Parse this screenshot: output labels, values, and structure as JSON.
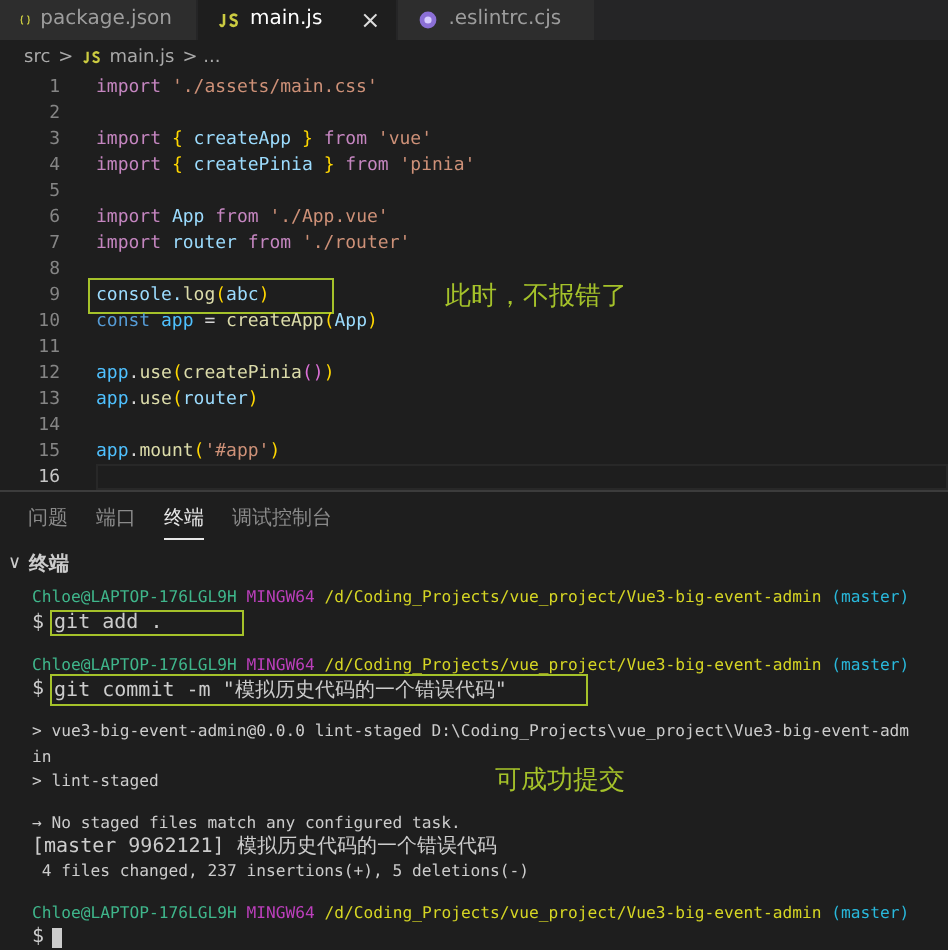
{
  "tabs": [
    {
      "label": "package.json",
      "selected": false
    },
    {
      "label": "main.js",
      "selected": true,
      "close": "×"
    },
    {
      "label": ".eslintrc.cjs",
      "selected": false
    }
  ],
  "breadcrumb": {
    "folder": "src",
    "sep": ">",
    "file": "main.js",
    "more": "> ..."
  },
  "code": [
    {
      "n": "1",
      "tokens": [
        {
          "t": "import ",
          "color": "#c586c0"
        },
        {
          "t": "'./assets/main.css'",
          "color": "#ce9178"
        }
      ]
    },
    {
      "n": "2"
    },
    {
      "n": "3",
      "tokens": [
        {
          "t": "import ",
          "color": "#c586c0"
        },
        {
          "t": "{ ",
          "color": "#ffd700"
        },
        {
          "t": "createApp ",
          "color": "#9cdcfe"
        },
        {
          "t": "} ",
          "color": "#ffd700"
        },
        {
          "t": "from ",
          "color": "#c586c0"
        },
        {
          "t": "'vue'",
          "color": "#ce9178"
        }
      ]
    },
    {
      "n": "4",
      "tokens": [
        {
          "t": "import ",
          "color": "#c586c0"
        },
        {
          "t": "{ ",
          "color": "#ffd700"
        },
        {
          "t": "createPinia ",
          "color": "#9cdcfe"
        },
        {
          "t": "} ",
          "color": "#ffd700"
        },
        {
          "t": "from ",
          "color": "#c586c0"
        },
        {
          "t": "'pinia'",
          "color": "#ce9178"
        }
      ]
    },
    {
      "n": "5"
    },
    {
      "n": "6",
      "tokens": [
        {
          "t": "import ",
          "color": "#c586c0"
        },
        {
          "t": "App ",
          "color": "#9cdcfe"
        },
        {
          "t": "from ",
          "color": "#c586c0"
        },
        {
          "t": "'./App.vue'",
          "color": "#ce9178"
        }
      ]
    },
    {
      "n": "7",
      "tokens": [
        {
          "t": "import ",
          "color": "#c586c0"
        },
        {
          "t": "router ",
          "color": "#9cdcfe"
        },
        {
          "t": "from ",
          "color": "#c586c0"
        },
        {
          "t": "'./router'",
          "color": "#ce9178"
        }
      ]
    },
    {
      "n": "8"
    },
    {
      "n": "9",
      "boxed": true,
      "tokens": [
        {
          "t": "console.",
          "color": "#9cdcfe"
        },
        {
          "t": "log",
          "color": "#dcdcaa"
        },
        {
          "t": "(",
          "color": "#ffd700"
        },
        {
          "t": "abc",
          "color": "#9cdcfe"
        },
        {
          "t": ")",
          "color": "#ffd700"
        }
      ],
      "note": "此时，不报错了"
    },
    {
      "n": "10",
      "tokens": [
        {
          "t": "const ",
          "color": "#569cd6"
        },
        {
          "t": "app ",
          "color": "#4fc1ff"
        },
        {
          "t": "= ",
          "color": "#d4d4d4"
        },
        {
          "t": "createApp",
          "color": "#dcdcaa"
        },
        {
          "t": "(",
          "color": "#ffd700"
        },
        {
          "t": "App",
          "color": "#9cdcfe"
        },
        {
          "t": ")",
          "color": "#ffd700"
        }
      ]
    },
    {
      "n": "11"
    },
    {
      "n": "12",
      "tokens": [
        {
          "t": "app",
          "color": "#4fc1ff"
        },
        {
          "t": ".",
          "color": "#d4d4d4"
        },
        {
          "t": "use",
          "color": "#dcdcaa"
        },
        {
          "t": "(",
          "color": "#ffd700"
        },
        {
          "t": "createPinia",
          "color": "#dcdcaa"
        },
        {
          "t": "()",
          "color": "#da70d6"
        },
        {
          "t": ")",
          "color": "#ffd700"
        }
      ]
    },
    {
      "n": "13",
      "tokens": [
        {
          "t": "app",
          "color": "#4fc1ff"
        },
        {
          "t": ".",
          "color": "#d4d4d4"
        },
        {
          "t": "use",
          "color": "#dcdcaa"
        },
        {
          "t": "(",
          "color": "#ffd700"
        },
        {
          "t": "router",
          "color": "#9cdcfe"
        },
        {
          "t": ")",
          "color": "#ffd700"
        }
      ]
    },
    {
      "n": "14"
    },
    {
      "n": "15",
      "tokens": [
        {
          "t": "app",
          "color": "#4fc1ff"
        },
        {
          "t": ".",
          "color": "#d4d4d4"
        },
        {
          "t": "mount",
          "color": "#dcdcaa"
        },
        {
          "t": "(",
          "color": "#ffd700"
        },
        {
          "t": "'#app'",
          "color": "#ce9178"
        },
        {
          "t": ")",
          "color": "#ffd700"
        }
      ]
    },
    {
      "n": "16",
      "current": true
    }
  ],
  "panel_tabs": [
    {
      "label": "问题",
      "selected": false
    },
    {
      "label": "端口",
      "selected": false
    },
    {
      "label": "终端",
      "selected": true
    },
    {
      "label": "调试控制台",
      "selected": false
    }
  ],
  "terminal": {
    "chevron": "∨",
    "title": "终端",
    "lines": [
      {
        "kind": "prompt",
        "user": "Chloe@LAPTOP-176LGL9H",
        "shell": "MINGW64",
        "path": "/d/Coding_Projects/vue_project/Vue3-big-event-admin",
        "branch": "(master)"
      },
      {
        "kind": "command",
        "dollar": "$",
        "text": "git add .",
        "boxed": true
      },
      {
        "kind": "blank"
      },
      {
        "kind": "prompt",
        "user": "Chloe@LAPTOP-176LGL9H",
        "shell": "MINGW64",
        "path": "/d/Coding_Projects/vue_project/Vue3-big-event-admin",
        "branch": "(master)"
      },
      {
        "kind": "command",
        "dollar": "$",
        "text": "git commit -m \"模拟历史代码的一个错误代码\"",
        "boxed": true
      },
      {
        "kind": "blank"
      },
      {
        "kind": "output",
        "text": "> vue3-big-event-admin@0.0.0 lint-staged D:\\Coding_Projects\\vue_project\\Vue3-big-event-adm"
      },
      {
        "kind": "output",
        "text": "in"
      },
      {
        "kind": "output",
        "text": "> lint-staged",
        "note": "可成功提交"
      },
      {
        "kind": "blank"
      },
      {
        "kind": "output",
        "text": "→ No staged files match any configured task."
      },
      {
        "kind": "result",
        "text": "[master 9962121] 模拟历史代码的一个错误代码"
      },
      {
        "kind": "output",
        "text": " 4 files changed, 237 insertions(+), 5 deletions(-)"
      },
      {
        "kind": "blank"
      },
      {
        "kind": "prompt",
        "user": "Chloe@LAPTOP-176LGL9H",
        "shell": "MINGW64",
        "path": "/d/Coding_Projects/vue_project/Vue3-big-event-admin",
        "branch": "(master)"
      },
      {
        "kind": "cursor",
        "dollar": "$"
      }
    ]
  }
}
